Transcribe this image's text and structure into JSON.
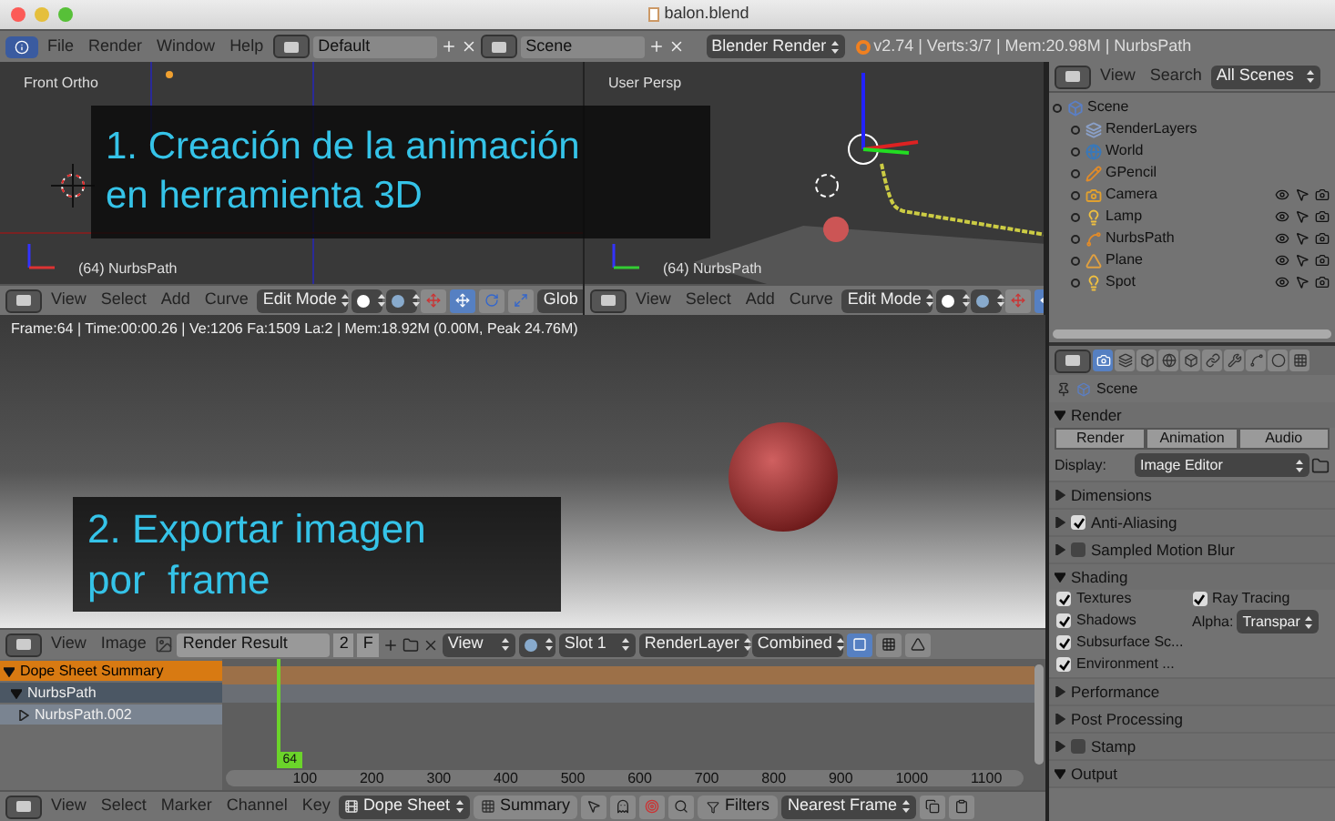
{
  "window": {
    "title": "balon.blend"
  },
  "info_header": {
    "menus": [
      "File",
      "Render",
      "Window",
      "Help"
    ],
    "layout": "Default",
    "scene": "Scene",
    "engine": "Blender Render",
    "stats": "v2.74 | Verts:3/7 | Mem:20.98M | NurbsPath"
  },
  "viewports": [
    {
      "label": "Front Ortho",
      "object": "(64) NurbsPath",
      "menus": [
        "View",
        "Select",
        "Add",
        "Curve"
      ],
      "mode": "Edit Mode",
      "orientation": "Glob",
      "kind": "ortho"
    },
    {
      "label": "User Persp",
      "object": "(64) NurbsPath",
      "menus": [
        "View",
        "Select",
        "Add",
        "Curve"
      ],
      "mode": "Edit Mode",
      "kind": "persp"
    }
  ],
  "render_view": {
    "status": "Frame:64 | Time:00:00.26 | Ve:1206 Fa:1509 La:2 | Mem:18.92M (0.00M, Peak 24.76M)"
  },
  "captions": [
    {
      "lines": [
        "1. Creación de la animación",
        "en herramienta 3D"
      ],
      "kind": "top"
    },
    {
      "lines": [
        "2. Exportar imagen",
        "por  frame"
      ],
      "kind": "bottom"
    }
  ],
  "image_header": {
    "menus": [
      "View",
      "Image"
    ],
    "image": "Render Result",
    "users": "2",
    "fake": "F",
    "view": "View",
    "slot": "Slot 1",
    "layer": "RenderLayer",
    "pass": "Combined"
  },
  "dope_sheet": {
    "channels": [
      {
        "label": "Dope Sheet Summary",
        "selected": true,
        "expanded": true,
        "children": [
          {
            "label": "NurbsPath",
            "selected": false,
            "expanded": true,
            "children": [
              {
                "label": "NurbsPath.002",
                "selected": false,
                "expanded": false
              }
            ]
          }
        ]
      }
    ],
    "playhead": {
      "label": "64",
      "level": 0.06
    },
    "ruler": [
      "100",
      "200",
      "300",
      "400",
      "500",
      "600",
      "700",
      "800",
      "900",
      "1000",
      "1100"
    ]
  },
  "dope_header": {
    "menus": [
      "View",
      "Select",
      "Marker",
      "Channel",
      "Key"
    ],
    "mode": "Dope Sheet",
    "summary": "Summary",
    "filters": "Filters",
    "snap": "Nearest Frame"
  },
  "outliner": {
    "menus": [
      "View",
      "Search"
    ],
    "display": "All Scenes",
    "tree": [
      {
        "label": "Scene",
        "kind": "scene",
        "children": [
          {
            "label": "RenderLayers",
            "kind": "renderlayers"
          },
          {
            "label": "World",
            "kind": "world"
          },
          {
            "label": "GPencil",
            "kind": "gpencil"
          },
          {
            "label": "Camera",
            "kind": "camera"
          },
          {
            "label": "Lamp",
            "kind": "lamp"
          },
          {
            "label": "NurbsPath",
            "kind": "curve"
          },
          {
            "label": "Plane",
            "kind": "mesh"
          },
          {
            "label": "Spot",
            "kind": "lamp"
          }
        ]
      }
    ]
  },
  "properties": {
    "tabs": [
      {
        "kind": "render",
        "selected": true
      },
      {
        "kind": "layers",
        "selected": false
      },
      {
        "kind": "scene",
        "selected": false
      },
      {
        "kind": "world",
        "selected": false
      },
      {
        "kind": "object",
        "selected": false
      },
      {
        "kind": "constraints",
        "selected": false
      },
      {
        "kind": "modifiers",
        "selected": false
      },
      {
        "kind": "data",
        "selected": false
      },
      {
        "kind": "material",
        "selected": false
      },
      {
        "kind": "texture",
        "selected": false
      }
    ],
    "breadcrumb": "Scene",
    "panels": [
      {
        "label": "Render",
        "expanded": true,
        "buttons": [
          "Render",
          "Animation",
          "Audio"
        ],
        "display_label": "Display:",
        "display": "Image Editor"
      },
      {
        "label": "Dimensions",
        "expanded": false
      },
      {
        "label": "Anti-Aliasing",
        "expanded": false,
        "checked": true
      },
      {
        "label": "Sampled Motion Blur",
        "expanded": false,
        "checked": false
      },
      {
        "label": "Shading",
        "expanded": true,
        "options_left": [
          {
            "label": "Textures",
            "checked": true
          },
          {
            "label": "Shadows",
            "checked": true
          },
          {
            "label": "Subsurface Sc...",
            "checked": true
          },
          {
            "label": "Environment ...",
            "checked": true
          }
        ],
        "options_right": [
          {
            "label": "Ray Tracing",
            "checked": true
          }
        ],
        "alpha_label": "Alpha:",
        "alpha": "Transpar"
      },
      {
        "label": "Performance",
        "expanded": false
      },
      {
        "label": "Post Processing",
        "expanded": false
      },
      {
        "label": "Stamp",
        "expanded": false,
        "checked": false
      },
      {
        "label": "Output",
        "expanded": true
      }
    ]
  }
}
